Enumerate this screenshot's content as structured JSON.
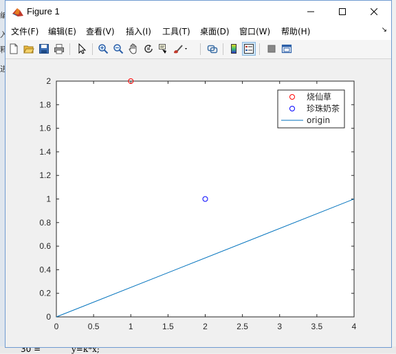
{
  "window": {
    "title": "Figure 1"
  },
  "menu": {
    "items": [
      {
        "label": "文件(F)"
      },
      {
        "label": "编辑(E)"
      },
      {
        "label": "查看(V)"
      },
      {
        "label": "插入(I)"
      },
      {
        "label": "工具(T)"
      },
      {
        "label": "桌面(D)"
      },
      {
        "label": "窗口(W)"
      },
      {
        "label": "帮助(H)"
      }
    ]
  },
  "toolbar": {
    "icons": [
      "new-figure-icon",
      "open-file-icon",
      "save-icon",
      "print-icon",
      "pointer-icon",
      "zoom-in-icon",
      "zoom-out-icon",
      "pan-icon",
      "rotate-3d-icon",
      "data-cursor-icon",
      "brush-icon",
      "link-plot-icon",
      "colorbar-icon",
      "legend-icon",
      "hide-plot-tools-icon",
      "show-plot-tools-icon"
    ]
  },
  "background": {
    "left_chars": [
      "编",
      "入",
      "释",
      "进"
    ],
    "bottom_left": "30 =",
    "bottom_code": "y=k*x;"
  },
  "chart_data": {
    "type": "scatter",
    "xlim": [
      0,
      4
    ],
    "ylim": [
      0,
      2
    ],
    "xticks": [
      "0",
      "0.5",
      "1",
      "1.5",
      "2",
      "2.5",
      "3",
      "3.5",
      "4"
    ],
    "yticks": [
      "0",
      "0.2",
      "0.4",
      "0.6",
      "0.8",
      "1",
      "1.2",
      "1.4",
      "1.6",
      "1.8",
      "2"
    ],
    "xtick_values": [
      0,
      0.5,
      1,
      1.5,
      2,
      2.5,
      3,
      3.5,
      4
    ],
    "ytick_values": [
      0,
      0.2,
      0.4,
      0.6,
      0.8,
      1,
      1.2,
      1.4,
      1.6,
      1.8,
      2
    ],
    "series": [
      {
        "name": "烧仙草",
        "marker": "circle",
        "color": "#ff0000",
        "x": [
          1
        ],
        "y": [
          2
        ]
      },
      {
        "name": "珍珠奶茶",
        "marker": "circle",
        "color": "#0000ff",
        "x": [
          2
        ],
        "y": [
          1
        ]
      },
      {
        "name": "origin",
        "marker": "line",
        "color": "#0072bd",
        "x": [
          0,
          4
        ],
        "y": [
          0,
          1
        ]
      }
    ],
    "legend_position": "top-right",
    "grid": false
  }
}
